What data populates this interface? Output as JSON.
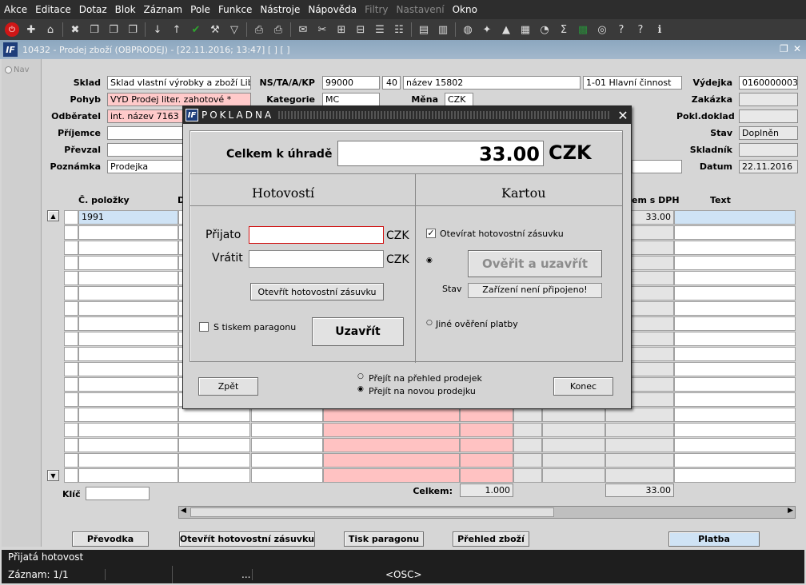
{
  "menu": [
    "Akce",
    "Editace",
    "Dotaz",
    "Blok",
    "Záznam",
    "Pole",
    "Funkce",
    "Nástroje",
    "Nápověda",
    "Filtry",
    "Nastavení",
    "Okno"
  ],
  "menu_disabled": [
    "Filtry",
    "Nastavení"
  ],
  "toolbar_icons": [
    "exit-icon",
    "add-record-icon",
    "add-home-icon",
    "delete-record-icon",
    "copy-icon",
    "copy2-icon",
    "copy3-icon",
    "sort-asc-icon",
    "sort-desc-icon",
    "check-icon",
    "wrench-icon",
    "filter-icon",
    "print-icon",
    "print2-icon",
    "mail-icon",
    "cut-icon",
    "tree-icon",
    "tree2-icon",
    "list-icon",
    "list2-icon",
    "doc-icon",
    "doc2-icon",
    "globe-icon",
    "settings-icon",
    "chart-icon",
    "report-icon",
    "chart2-icon",
    "sigma-icon",
    "excel-icon",
    "bank-icon",
    "help-icon",
    "help2-icon",
    "info-icon"
  ],
  "window": {
    "logo": "IF",
    "title": "10432 - Prodej zboží (OBPRODEJ) - [22.11.2016; 13:47]  [ ]  [ ]"
  },
  "nav": "Nav",
  "form": {
    "sklad_label": "Sklad",
    "sklad_value": "Sklad vlastní výrobky a zboží Liberec",
    "pohyb_label": "Pohyb",
    "pohyb_value": "VYD Prodej liter. zahotové *",
    "odberatel_label": "Odběratel",
    "odberatel_value": "int. název 7163",
    "prijemce_label": "Příjemce",
    "prevzal_label": "Převzal",
    "poznamka_label": "Poznámka",
    "poznamka_value": "Prodejka",
    "ns_label": "NS/TA/A/KP",
    "ns_value": "99000",
    "ta_value": "40",
    "a_value": "název 15802",
    "kp_value": "1-01 Hlavní činnost",
    "kategorie_label": "Kategorie",
    "kategorie_value": "MC",
    "mena_label": "Měna",
    "mena_value": "CZK",
    "vydejka_label": "Výdejka",
    "vydejka_value": "0160000003",
    "zakazka_label": "Zakázka",
    "pokl_label": "Pokl.doklad",
    "stav_label": "Stav",
    "stav_value": "Doplněn",
    "skladnik_label": "Skladník",
    "datum_label": "Datum",
    "datum_value": "22.11.2016"
  },
  "grid": {
    "col_polozky": "Č. položky",
    "col_d": "D",
    "col_sdph": "em s DPH",
    "col_text": "Text",
    "row1_polozka": "1991",
    "row1_sdph": "33.00"
  },
  "footer": {
    "klic_label": "Klíč",
    "celkem_label": "Celkem:",
    "celkem_qty": "1.000",
    "celkem_sum": "33.00"
  },
  "buttons": {
    "prevodka": "Převodka",
    "otevrit": "Otevřít hotovostní zásuvku",
    "tisk": "Tisk paragonu",
    "prehled": "Přehled zboží",
    "platba": "Platba"
  },
  "status": {
    "line1": "Přijatá hotovost",
    "line2": "Záznam: 1/1",
    "dots": "...",
    "osc": "<OSC>"
  },
  "dialog": {
    "logo": "IF",
    "title": "POKLADNA",
    "celkem_label": "Celkem k úhradě",
    "celkem_value": "33.00",
    "currency": "CZK",
    "hotovosti": "Hotovostí",
    "kartou": "Kartou",
    "prijato_label": "Přijato",
    "prijato_value": "",
    "vratit_label": "Vrátit",
    "vratit_value": "",
    "czk": "CZK",
    "otevrit_btn": "Otevřít hotovostní zásuvku",
    "tisk_chk": "S tiskem paragonu",
    "uzavrit_btn": "Uzavřít",
    "otevirat_chk": "Otevírat hotovostní zásuvku",
    "overit_btn": "Ověřit a uzavřít",
    "stav_label": "Stav",
    "stav_value": "Zařízení není připojeno!",
    "jine_radio": "Jiné ověření platby",
    "zpet_btn": "Zpět",
    "radio1": "Přejít na přehled prodejek",
    "radio2": "Přejít na novou prodejku",
    "konec_btn": "Konec"
  }
}
